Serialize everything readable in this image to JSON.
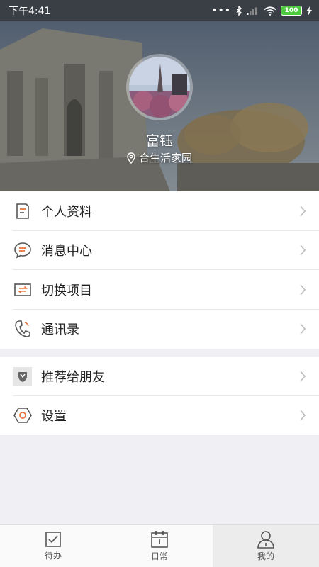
{
  "status_bar": {
    "time": "下午4:41",
    "battery": "100"
  },
  "profile": {
    "name": "富钰",
    "location": "合生活家园"
  },
  "menu_group_1": [
    {
      "label": "个人资料",
      "icon": "document-icon"
    },
    {
      "label": "消息中心",
      "icon": "chat-icon"
    },
    {
      "label": "切换项目",
      "icon": "swap-icon"
    },
    {
      "label": "通讯录",
      "icon": "phone-icon"
    }
  ],
  "menu_group_2": [
    {
      "label": "推荐给朋友",
      "icon": "shield-icon"
    },
    {
      "label": "设置",
      "icon": "hexagon-settings-icon"
    }
  ],
  "tabs": [
    {
      "label": "待办",
      "icon": "checkbox-icon",
      "active": false
    },
    {
      "label": "日常",
      "icon": "calendar-icon",
      "active": false
    },
    {
      "label": "我的",
      "icon": "person-icon",
      "active": true
    }
  ],
  "colors": {
    "accent": "#e8743b",
    "icon_gray": "#555555"
  }
}
